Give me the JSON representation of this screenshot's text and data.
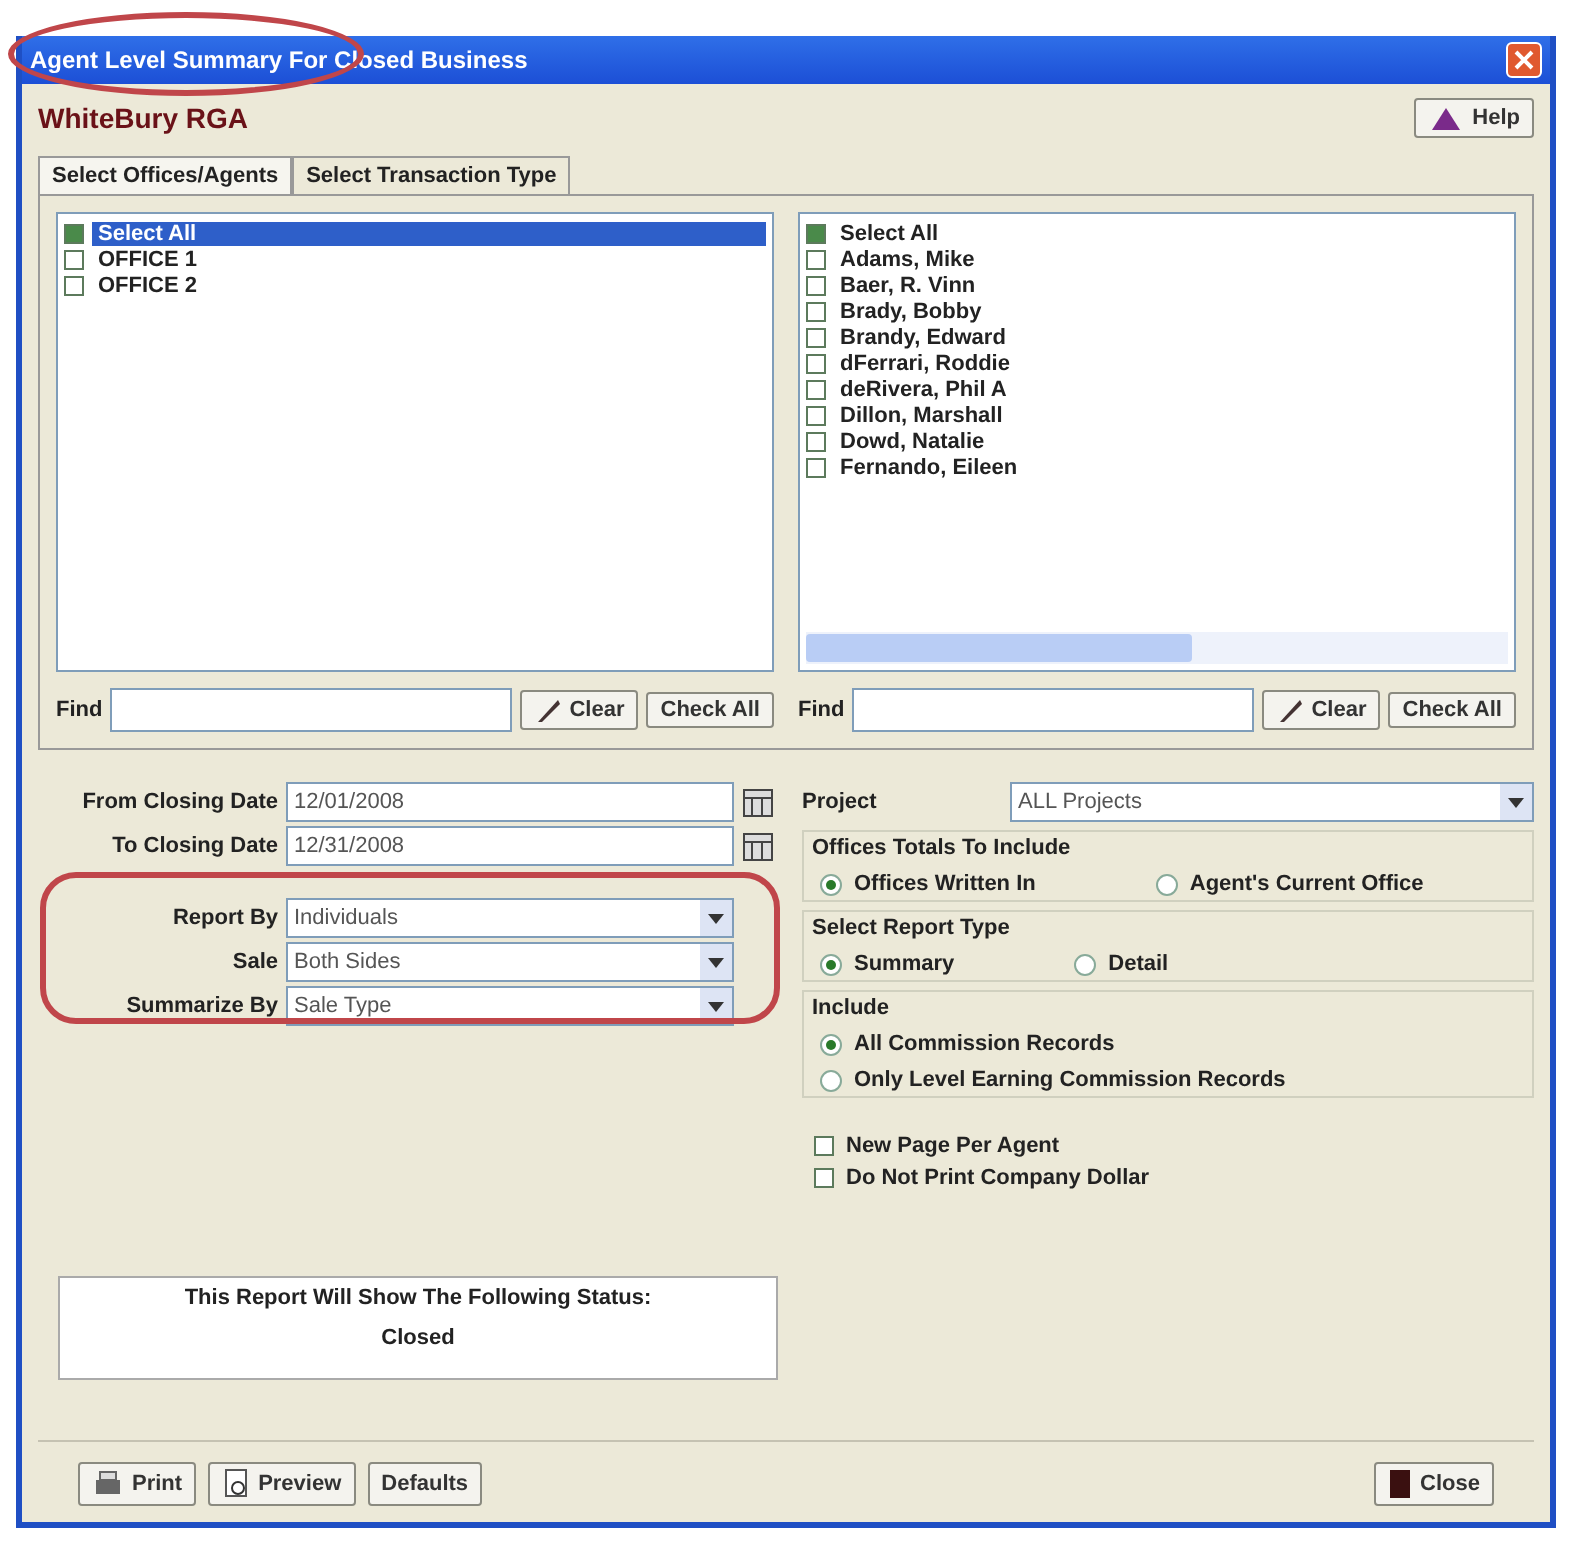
{
  "window": {
    "title": "Agent Level Summary For Closed Business"
  },
  "header": {
    "logo": "WhiteBury RGA",
    "help_button": "Help"
  },
  "tabs": [
    {
      "label": "Select Offices/Agents",
      "selected": true
    },
    {
      "label": "Select Transaction Type",
      "selected": false
    }
  ],
  "offices_panel": {
    "items": [
      {
        "label": "Select All",
        "checked": true,
        "selected": true
      },
      {
        "label": "OFFICE 1",
        "checked": false,
        "selected": false
      },
      {
        "label": "OFFICE 2",
        "checked": false,
        "selected": false
      }
    ],
    "find_label": "Find",
    "clear_button": "Clear",
    "check_all_button": "Check All"
  },
  "agents_panel": {
    "items": [
      {
        "label": "Select All",
        "checked": true,
        "selected": false
      },
      {
        "label": "Adams, Mike",
        "checked": false,
        "selected": false
      },
      {
        "label": "Baer, R. Vinn",
        "checked": false,
        "selected": false
      },
      {
        "label": "Brady, Bobby",
        "checked": false,
        "selected": false
      },
      {
        "label": "Brandy, Edward",
        "checked": false,
        "selected": false
      },
      {
        "label": "dFerrari, Roddie",
        "checked": false,
        "selected": false
      },
      {
        "label": "deRivera, Phil A",
        "checked": false,
        "selected": false
      },
      {
        "label": "Dillon, Marshall",
        "checked": false,
        "selected": false
      },
      {
        "label": "Dowd, Natalie",
        "checked": false,
        "selected": false
      },
      {
        "label": "Fernando, Eileen",
        "checked": false,
        "selected": false
      }
    ],
    "find_label": "Find",
    "clear_button": "Clear",
    "check_all_button": "Check All"
  },
  "dates": [
    {
      "label": "From Closing Date",
      "value": "12/01/2008"
    },
    {
      "label": "To Closing Date",
      "value": "12/31/2008"
    }
  ],
  "selects": [
    {
      "label": "Report By",
      "value": "Individuals"
    },
    {
      "label": "Sale",
      "value": "Both Sides"
    },
    {
      "label": "Summarize By",
      "value": "Sale Type"
    }
  ],
  "status_box": {
    "heading": "This Report Will Show The Following Status:",
    "value": "Closed"
  },
  "project": {
    "label": "Project",
    "value": "ALL Projects"
  },
  "radio_groups": [
    {
      "title": "Offices Totals To Include",
      "options": [
        {
          "label": "Offices Written In",
          "selected": true
        },
        {
          "label": "Agent's Current Office",
          "selected": false
        }
      ]
    },
    {
      "title": "Select Report Type",
      "options": [
        {
          "label": "Summary",
          "selected": true
        },
        {
          "label": "Detail",
          "selected": false
        }
      ]
    },
    {
      "title": "Include",
      "options": [
        {
          "label": "All Commission Records",
          "selected": true
        },
        {
          "label": "Only Level Earning Commission Records",
          "selected": false
        }
      ]
    }
  ],
  "options": [
    {
      "label": "New Page Per Agent",
      "checked": false
    },
    {
      "label": "Do Not Print Company Dollar",
      "checked": false
    }
  ],
  "footer_buttons": [
    {
      "label": "Print"
    },
    {
      "label": "Preview"
    },
    {
      "label": "Defaults"
    }
  ],
  "close_button": {
    "label": "Close"
  }
}
